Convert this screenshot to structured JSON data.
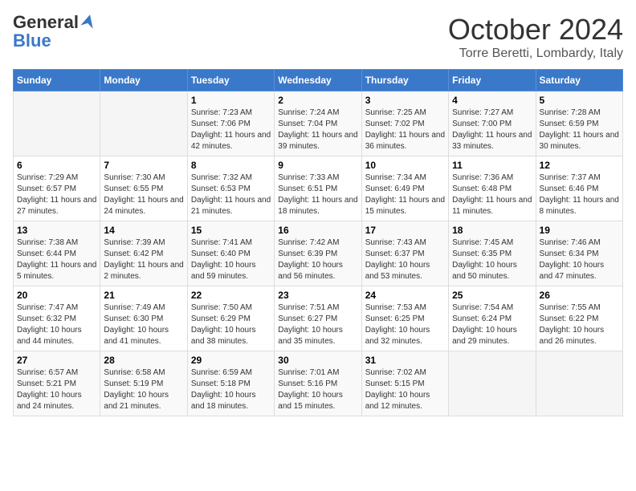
{
  "header": {
    "logo_general": "General",
    "logo_blue": "Blue",
    "month": "October 2024",
    "location": "Torre Beretti, Lombardy, Italy"
  },
  "days_of_week": [
    "Sunday",
    "Monday",
    "Tuesday",
    "Wednesday",
    "Thursday",
    "Friday",
    "Saturday"
  ],
  "weeks": [
    [
      {
        "day": "",
        "info": ""
      },
      {
        "day": "",
        "info": ""
      },
      {
        "day": "1",
        "info": "Sunrise: 7:23 AM\nSunset: 7:06 PM\nDaylight: 11 hours and 42 minutes."
      },
      {
        "day": "2",
        "info": "Sunrise: 7:24 AM\nSunset: 7:04 PM\nDaylight: 11 hours and 39 minutes."
      },
      {
        "day": "3",
        "info": "Sunrise: 7:25 AM\nSunset: 7:02 PM\nDaylight: 11 hours and 36 minutes."
      },
      {
        "day": "4",
        "info": "Sunrise: 7:27 AM\nSunset: 7:00 PM\nDaylight: 11 hours and 33 minutes."
      },
      {
        "day": "5",
        "info": "Sunrise: 7:28 AM\nSunset: 6:59 PM\nDaylight: 11 hours and 30 minutes."
      }
    ],
    [
      {
        "day": "6",
        "info": "Sunrise: 7:29 AM\nSunset: 6:57 PM\nDaylight: 11 hours and 27 minutes."
      },
      {
        "day": "7",
        "info": "Sunrise: 7:30 AM\nSunset: 6:55 PM\nDaylight: 11 hours and 24 minutes."
      },
      {
        "day": "8",
        "info": "Sunrise: 7:32 AM\nSunset: 6:53 PM\nDaylight: 11 hours and 21 minutes."
      },
      {
        "day": "9",
        "info": "Sunrise: 7:33 AM\nSunset: 6:51 PM\nDaylight: 11 hours and 18 minutes."
      },
      {
        "day": "10",
        "info": "Sunrise: 7:34 AM\nSunset: 6:49 PM\nDaylight: 11 hours and 15 minutes."
      },
      {
        "day": "11",
        "info": "Sunrise: 7:36 AM\nSunset: 6:48 PM\nDaylight: 11 hours and 11 minutes."
      },
      {
        "day": "12",
        "info": "Sunrise: 7:37 AM\nSunset: 6:46 PM\nDaylight: 11 hours and 8 minutes."
      }
    ],
    [
      {
        "day": "13",
        "info": "Sunrise: 7:38 AM\nSunset: 6:44 PM\nDaylight: 11 hours and 5 minutes."
      },
      {
        "day": "14",
        "info": "Sunrise: 7:39 AM\nSunset: 6:42 PM\nDaylight: 11 hours and 2 minutes."
      },
      {
        "day": "15",
        "info": "Sunrise: 7:41 AM\nSunset: 6:40 PM\nDaylight: 10 hours and 59 minutes."
      },
      {
        "day": "16",
        "info": "Sunrise: 7:42 AM\nSunset: 6:39 PM\nDaylight: 10 hours and 56 minutes."
      },
      {
        "day": "17",
        "info": "Sunrise: 7:43 AM\nSunset: 6:37 PM\nDaylight: 10 hours and 53 minutes."
      },
      {
        "day": "18",
        "info": "Sunrise: 7:45 AM\nSunset: 6:35 PM\nDaylight: 10 hours and 50 minutes."
      },
      {
        "day": "19",
        "info": "Sunrise: 7:46 AM\nSunset: 6:34 PM\nDaylight: 10 hours and 47 minutes."
      }
    ],
    [
      {
        "day": "20",
        "info": "Sunrise: 7:47 AM\nSunset: 6:32 PM\nDaylight: 10 hours and 44 minutes."
      },
      {
        "day": "21",
        "info": "Sunrise: 7:49 AM\nSunset: 6:30 PM\nDaylight: 10 hours and 41 minutes."
      },
      {
        "day": "22",
        "info": "Sunrise: 7:50 AM\nSunset: 6:29 PM\nDaylight: 10 hours and 38 minutes."
      },
      {
        "day": "23",
        "info": "Sunrise: 7:51 AM\nSunset: 6:27 PM\nDaylight: 10 hours and 35 minutes."
      },
      {
        "day": "24",
        "info": "Sunrise: 7:53 AM\nSunset: 6:25 PM\nDaylight: 10 hours and 32 minutes."
      },
      {
        "day": "25",
        "info": "Sunrise: 7:54 AM\nSunset: 6:24 PM\nDaylight: 10 hours and 29 minutes."
      },
      {
        "day": "26",
        "info": "Sunrise: 7:55 AM\nSunset: 6:22 PM\nDaylight: 10 hours and 26 minutes."
      }
    ],
    [
      {
        "day": "27",
        "info": "Sunrise: 6:57 AM\nSunset: 5:21 PM\nDaylight: 10 hours and 24 minutes."
      },
      {
        "day": "28",
        "info": "Sunrise: 6:58 AM\nSunset: 5:19 PM\nDaylight: 10 hours and 21 minutes."
      },
      {
        "day": "29",
        "info": "Sunrise: 6:59 AM\nSunset: 5:18 PM\nDaylight: 10 hours and 18 minutes."
      },
      {
        "day": "30",
        "info": "Sunrise: 7:01 AM\nSunset: 5:16 PM\nDaylight: 10 hours and 15 minutes."
      },
      {
        "day": "31",
        "info": "Sunrise: 7:02 AM\nSunset: 5:15 PM\nDaylight: 10 hours and 12 minutes."
      },
      {
        "day": "",
        "info": ""
      },
      {
        "day": "",
        "info": ""
      }
    ]
  ]
}
